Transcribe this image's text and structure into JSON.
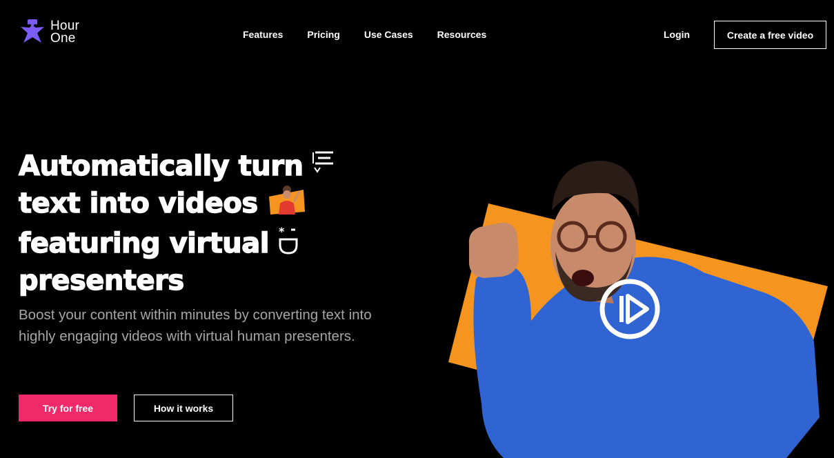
{
  "brand": {
    "name_line1": "Hour",
    "name_line2": "One",
    "color": "#7b5cf5"
  },
  "nav": {
    "items": [
      {
        "label": "Features"
      },
      {
        "label": "Pricing"
      },
      {
        "label": "Use Cases"
      },
      {
        "label": "Resources"
      }
    ],
    "login_label": "Login",
    "cta_label": "Create a free video"
  },
  "hero": {
    "headline_line1": "Automatically turn",
    "headline_line2": "text into videos",
    "headline_line3": "featuring virtual",
    "headline_line4": "presenters",
    "subtext": "Boost your content within minutes by converting text into highly engaging videos with virtual human presenters.",
    "primary_button": "Try for free",
    "secondary_button": "How it works",
    "accent_color": "#f0296a",
    "frame_color": "#f5951f",
    "sweater_color": "#2f64d2"
  },
  "icons": {
    "text_icon": "text-lines-icon",
    "presenter_thumb": "presenter-thumbnail",
    "face_icon": "smiley-sparkle-icon",
    "play": "play-icon"
  }
}
